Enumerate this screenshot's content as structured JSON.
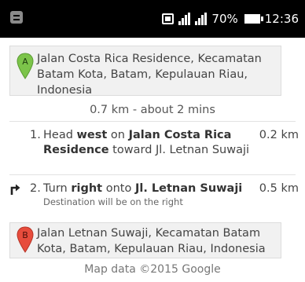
{
  "status_bar": {
    "battery_percent": "70%",
    "time": "12:36",
    "status_bg": "#000000"
  },
  "origin": {
    "marker": "A",
    "marker_color": "#7cc44a",
    "address": "Jalan Costa Rica Residence, Kecamatan Batam Kota, Batam, Kepulauan Riau, Indonesia"
  },
  "route_summary": "0.7 km - about 2 mins",
  "steps": [
    {
      "number": "1.",
      "direction_icon": "",
      "parts": [
        "Head ",
        "west",
        " on ",
        "Jalan Costa Rica Residence",
        " toward Jl. Letnan Suwaji"
      ],
      "distance": "0.2 km",
      "note": ""
    },
    {
      "number": "2.",
      "direction_icon": "turn-right-icon",
      "parts": [
        "Turn ",
        "right",
        " onto ",
        "Jl. Letnan Suwaji"
      ],
      "distance": "0.5 km",
      "note": "Destination will be on the right"
    }
  ],
  "destination": {
    "marker": "B",
    "marker_color": "#e74c3c",
    "address": "Jalan Letnan Suwaji, Kecamatan Batam Kota, Batam, Kepulauan Riau, Indonesia"
  },
  "footer": "Map data ©2015 Google"
}
